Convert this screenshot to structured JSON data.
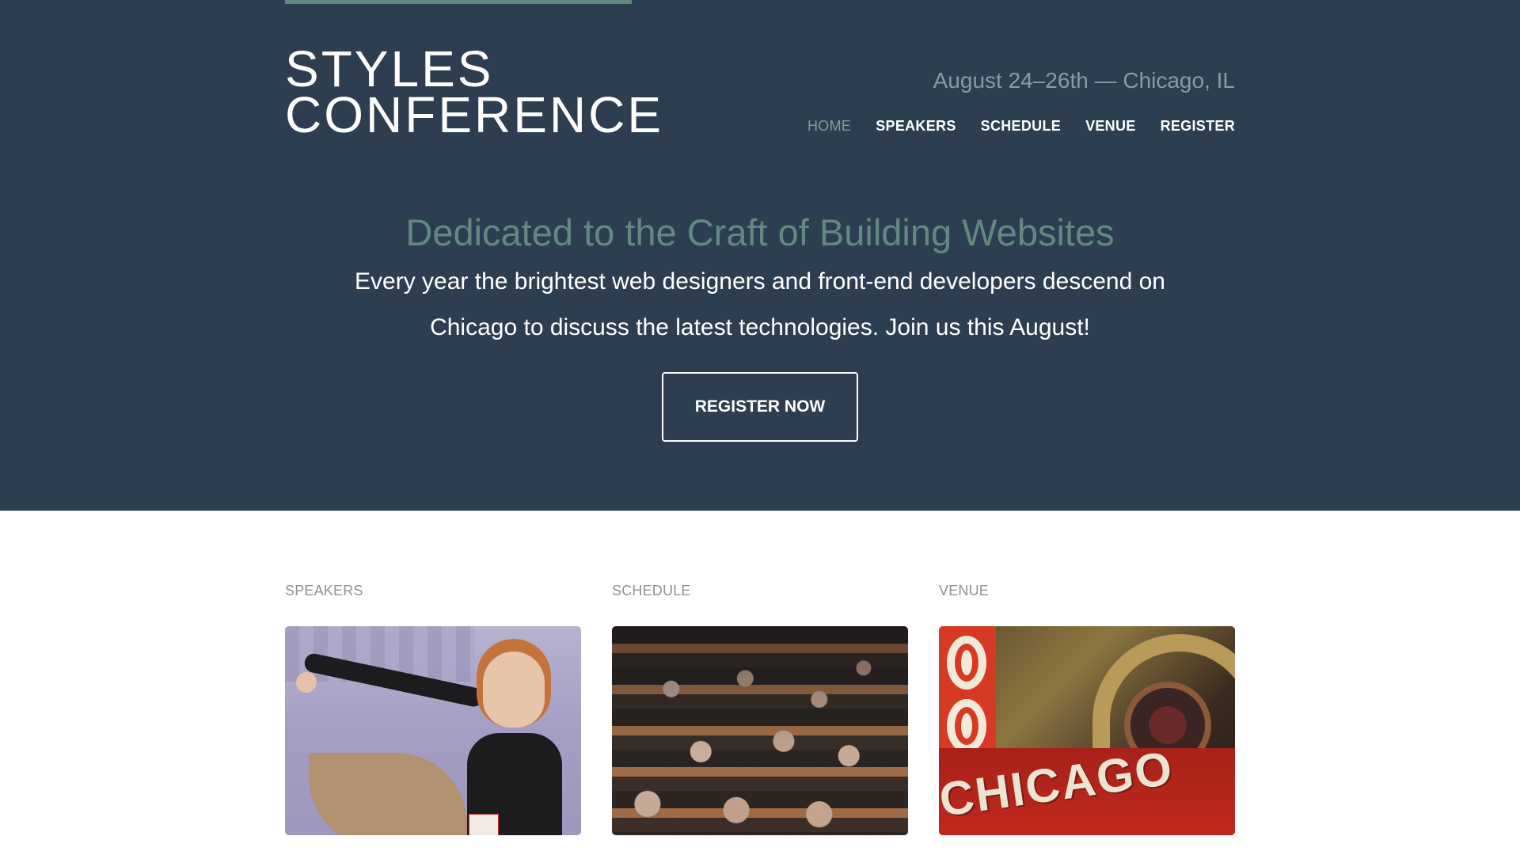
{
  "brand": {
    "line1": "STYLES",
    "line2": "CONFERENCE"
  },
  "event": {
    "date_location": "August 24–26th — Chicago, IL"
  },
  "nav": {
    "items": [
      {
        "label": "HOME",
        "active": true
      },
      {
        "label": "SPEAKERS",
        "active": false
      },
      {
        "label": "SCHEDULE",
        "active": false
      },
      {
        "label": "VENUE",
        "active": false
      },
      {
        "label": "REGISTER",
        "active": false
      }
    ]
  },
  "hero": {
    "title": "Dedicated to the Craft of Building Websites",
    "lead": "Every year the brightest web designers and front-end developers descend on Chicago to discuss the latest technologies. Join us this August!",
    "cta_label": "REGISTER NOW"
  },
  "teasers": [
    {
      "label": "SPEAKERS",
      "image": "speaker presenting on stage"
    },
    {
      "label": "SCHEDULE",
      "image": "audience seated in auditorium"
    },
    {
      "label": "VENUE",
      "image": "Chicago theatre marquee sign",
      "sign_text": "CHICAGO"
    }
  ],
  "colors": {
    "hero_bg": "#2c3e50",
    "accent": "#648880",
    "white": "#ffffff",
    "muted_label": "#8a9399"
  }
}
